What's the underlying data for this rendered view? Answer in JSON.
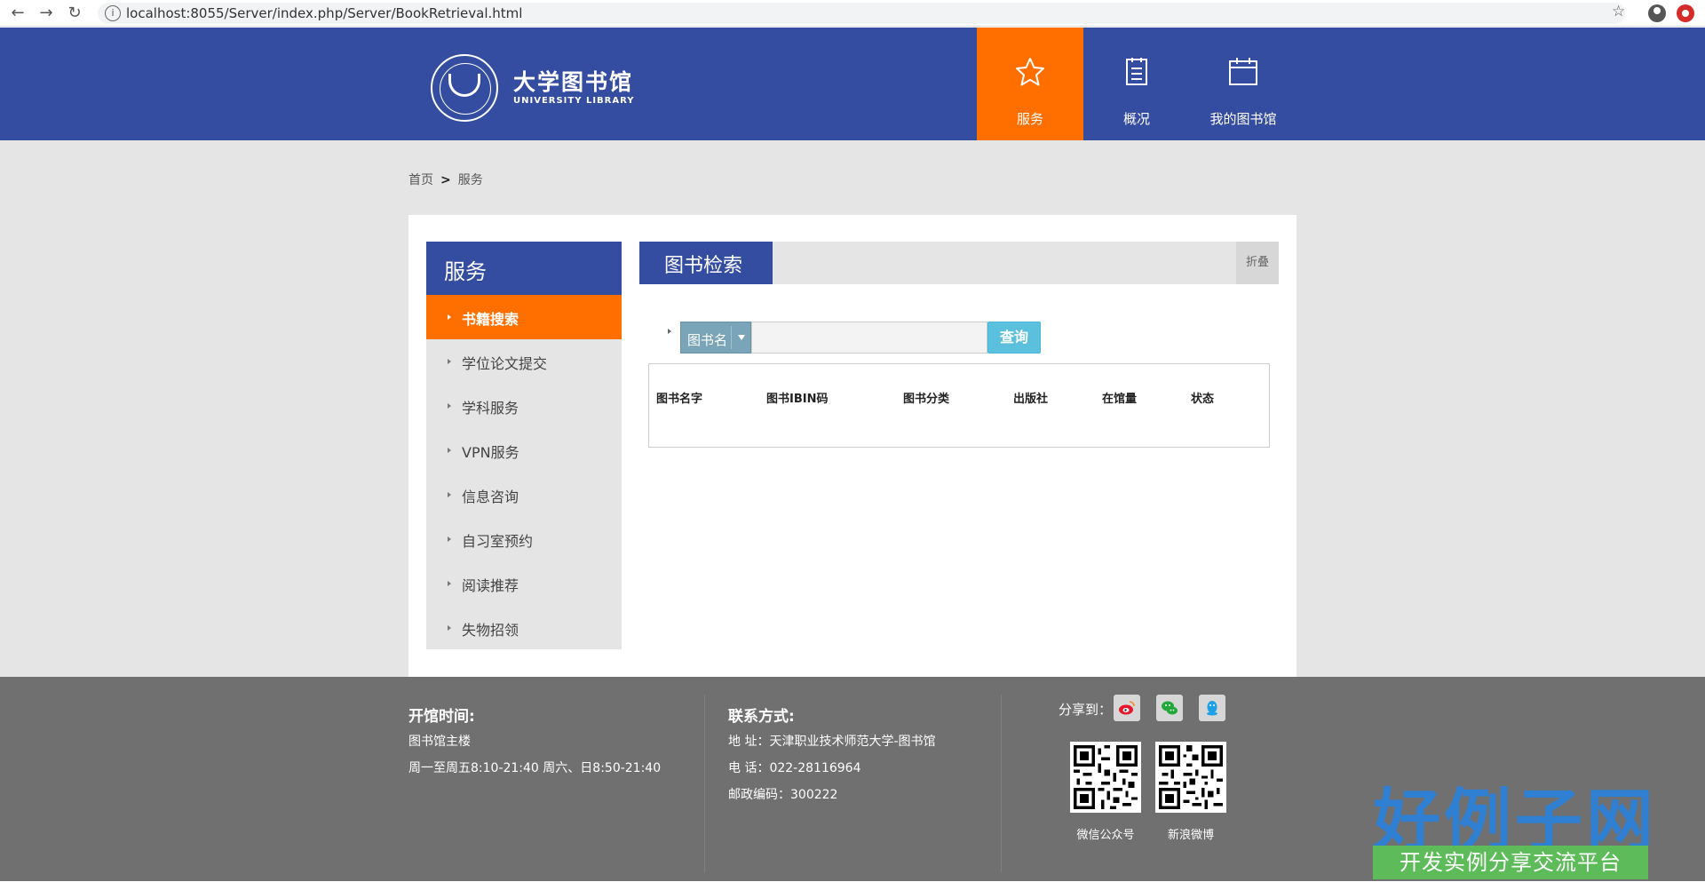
{
  "browser": {
    "url": "localhost:8055/Server/index.php/Server/BookRetrieval.html"
  },
  "header": {
    "logo_title": "大学图书馆",
    "logo_subtitle": "UNIVERSITY LIBRARY",
    "nav": [
      {
        "label": "服务",
        "icon": "star-icon"
      },
      {
        "label": "概况",
        "icon": "document-icon"
      },
      {
        "label": "我的图书馆",
        "icon": "calendar-icon"
      }
    ]
  },
  "breadcrumb": {
    "home": "首页",
    "separator": ">",
    "current": "服务"
  },
  "sidebar": {
    "title": "服务",
    "items": [
      {
        "label": "书籍搜索"
      },
      {
        "label": "学位论文提交"
      },
      {
        "label": "学科服务"
      },
      {
        "label": "VPN服务"
      },
      {
        "label": "信息咨询"
      },
      {
        "label": "自习室预约"
      },
      {
        "label": "阅读推荐"
      },
      {
        "label": "失物招领"
      }
    ]
  },
  "main": {
    "section_title": "图书检索",
    "collapse_label": "折叠",
    "search": {
      "field_selected": "图书名",
      "input_value": "",
      "button_label": "查询"
    },
    "table": {
      "columns": [
        "图书名字",
        "图书IBIN码",
        "图书分类",
        "出版社",
        "在馆量",
        "状态"
      ]
    }
  },
  "footer": {
    "hours_title": "开馆时间:",
    "hours_place": "图书馆主楼",
    "hours_detail": "周一至周五8:10-21:40 周六、日8:50-21:40",
    "contact_title": "联系方式:",
    "address": "地 址：天津职业技术师范大学-图书馆",
    "phone": "电 话：022-28116964",
    "postcode": "邮政编码：300222",
    "share_label": "分享到：",
    "share_icons": [
      "weibo-icon",
      "wechat-icon",
      "qq-icon"
    ],
    "qr_codes": [
      {
        "label": "微信公众号"
      },
      {
        "label": "新浪微博"
      }
    ]
  },
  "watermark": {
    "brand": "好例子网",
    "tagline": "开发实例分享交流平台"
  },
  "colors": {
    "brand_blue": "#354da0",
    "accent_orange": "#ff6f00",
    "search_button": "#5bc0de",
    "footer_gray": "#707070"
  }
}
